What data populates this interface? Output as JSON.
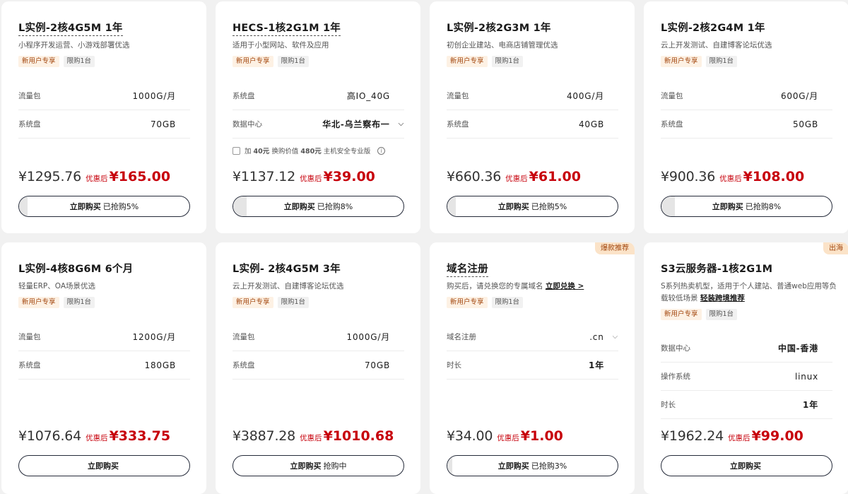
{
  "cards": [
    {
      "title": "L实例-2核4G5M 1年",
      "desc": "小程序开发运营、小游戏部署优选",
      "tags": [
        "新用户专享",
        "限购1台"
      ],
      "specs": [
        {
          "label": "流量包",
          "value": "1000G/月"
        },
        {
          "label": "系统盘",
          "value": "70GB"
        }
      ],
      "orig_price": "¥1295.76",
      "price_label": "优惠后",
      "price": "¥165.00",
      "buy_label": "立即购买",
      "buy_status": "已抢购5%",
      "progress": 0.05
    },
    {
      "title": "HECS-1核2G1M 1年",
      "desc": "适用于小型网站、软件及应用",
      "tags": [
        "新用户专享",
        "限购1台"
      ],
      "specs": [
        {
          "label": "系统盘",
          "value": "高IO_40G"
        },
        {
          "label": "数据中心",
          "value": "华北-乌兰察布一"
        }
      ],
      "addon_prefix": "加",
      "addon_price": "40元",
      "addon_mid": "换购价值",
      "addon_value": "480元",
      "addon_suffix": "主机安全专业版",
      "orig_price": "¥1137.12",
      "price_label": "优惠后",
      "price": "¥39.00",
      "buy_label": "立即购买",
      "buy_status": "已抢购8%",
      "progress": 0.08
    },
    {
      "title": "L实例-2核2G3M 1年",
      "desc": "初创企业建站、电商店铺管理优选",
      "tags": [
        "新用户专享",
        "限购1台"
      ],
      "specs": [
        {
          "label": "流量包",
          "value": "400G/月"
        },
        {
          "label": "系统盘",
          "value": "40GB"
        }
      ],
      "orig_price": "¥660.36",
      "price_label": "优惠后",
      "price": "¥61.00",
      "buy_label": "立即购买",
      "buy_status": "已抢购5%",
      "progress": 0.05
    },
    {
      "title": "L实例-2核2G4M 1年",
      "desc": "云上开发测试、自建博客论坛优选",
      "tags": [
        "新用户专享",
        "限购1台"
      ],
      "specs": [
        {
          "label": "流量包",
          "value": "600G/月"
        },
        {
          "label": "系统盘",
          "value": "50GB"
        }
      ],
      "orig_price": "¥900.36",
      "price_label": "优惠后",
      "price": "¥108.00",
      "buy_label": "立即购买",
      "buy_status": "已抢购8%",
      "progress": 0.08
    },
    {
      "title": "L实例-4核8G6M 6个月",
      "desc": "轻量ERP、OA场景优选",
      "tags": [
        "新用户专享",
        "限购1台"
      ],
      "specs": [
        {
          "label": "流量包",
          "value": "1200G/月"
        },
        {
          "label": "系统盘",
          "value": "180GB"
        }
      ],
      "orig_price": "¥1076.64",
      "price_label": "优惠后",
      "price": "¥333.75",
      "buy_label": "立即购买",
      "buy_status": ""
    },
    {
      "title": "L实例- 2核4G5M 3年",
      "desc": "云上开发测试、自建博客论坛优选",
      "tags": [
        "新用户专享",
        "限购1台"
      ],
      "specs": [
        {
          "label": "流量包",
          "value": "1000G/月"
        },
        {
          "label": "系统盘",
          "value": "70GB"
        }
      ],
      "orig_price": "¥3887.28",
      "price_label": "优惠后",
      "price": "¥1010.68",
      "buy_label": "立即购买",
      "buy_status": "抢购中"
    },
    {
      "corner": "爆款推荐",
      "title": "域名注册",
      "desc": "购买后，请兑换您的专属域名",
      "desc_link": "立即兑换 >",
      "tags": [
        "新用户专享",
        "限购1台"
      ],
      "specs": [
        {
          "label": "域名注册",
          "value": ".cn"
        },
        {
          "label": "时长",
          "value": "1年"
        }
      ],
      "orig_price": "¥34.00",
      "price_label": "优惠后",
      "price": "¥1.00",
      "buy_label": "立即购买",
      "buy_status": "已抢购3%",
      "progress": 0.03
    },
    {
      "corner": "出海",
      "title": "S3云服务器-1核2G1M",
      "desc": "S系列热卖机型，适用于个人建站、普通web应用等负载较低场景",
      "desc_link": "轻装跨境推荐",
      "tags": [
        "新用户专享",
        "限购1台"
      ],
      "specs": [
        {
          "label": "数据中心",
          "value": "中国-香港"
        },
        {
          "label": "操作系统",
          "value": "linux"
        },
        {
          "label": "时长",
          "value": "1年"
        }
      ],
      "orig_price": "¥1962.24",
      "price_label": "优惠后",
      "price": "¥99.00",
      "buy_label": "立即购买",
      "buy_status": ""
    }
  ]
}
